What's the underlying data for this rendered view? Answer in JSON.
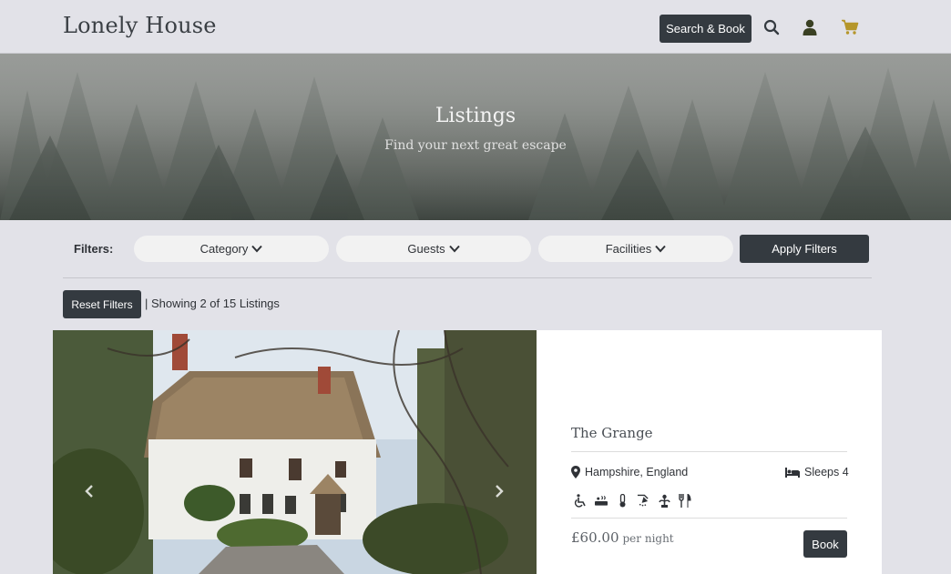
{
  "navbar": {
    "brand": "Lonely House",
    "search_book_label": "Search & Book",
    "icons": [
      "search-icon",
      "user-icon",
      "cart-icon"
    ],
    "cart_color": "#b5962a"
  },
  "hero": {
    "title": "Listings",
    "subtitle": "Find your next great escape"
  },
  "filters": {
    "label": "Filters:",
    "dropdowns": [
      {
        "label": "Category"
      },
      {
        "label": "Guests"
      },
      {
        "label": "Facilities"
      }
    ],
    "apply_label": "Apply Filters",
    "reset_label": "Reset Filters",
    "showing_text": "| Showing 2 of 15 Listings"
  },
  "listing": {
    "title": "The Grange",
    "location": "Hampshire, England",
    "sleeps": "Sleeps 4",
    "facility_icons": [
      "wheelchair-icon",
      "hot-tub-icon",
      "thermometer-icon",
      "shower-icon",
      "garden-icon",
      "restaurant-icon"
    ],
    "price": "£60.00",
    "price_unit": "per night",
    "book_label": "Book"
  },
  "colors": {
    "dark_button": "#343a40",
    "page_bg": "#e2e2e8",
    "pill_bg": "#f2f2f2"
  }
}
